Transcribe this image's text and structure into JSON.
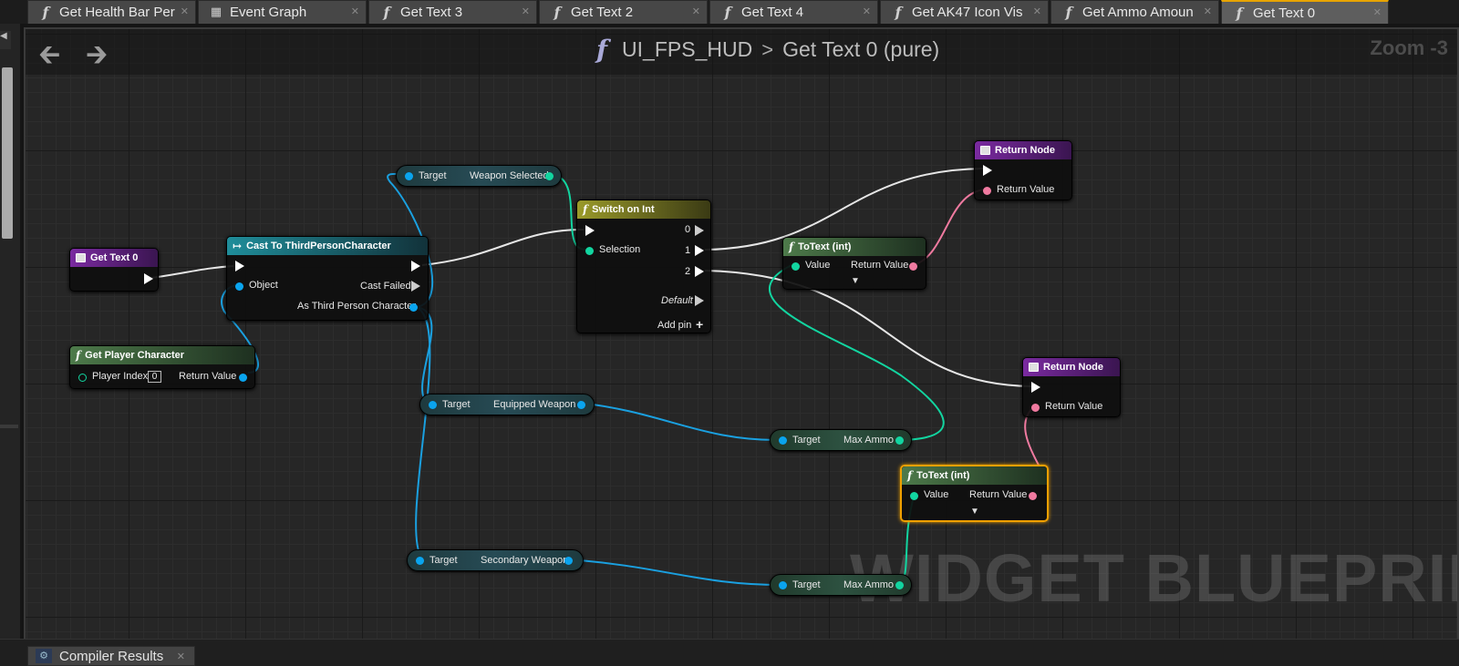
{
  "tabs": [
    {
      "label": "Get Health Bar Per",
      "icon": "function-icon",
      "active": false
    },
    {
      "label": "Event Graph",
      "icon": "event-graph-icon",
      "active": false
    },
    {
      "label": "Get Text 3",
      "icon": "function-icon",
      "active": false
    },
    {
      "label": "Get Text 2",
      "icon": "function-icon",
      "active": false
    },
    {
      "label": "Get Text 4",
      "icon": "function-icon",
      "active": false
    },
    {
      "label": "Get AK47 Icon Vis",
      "icon": "function-icon",
      "active": false
    },
    {
      "label": "Get Ammo Amoun",
      "icon": "function-icon",
      "active": false
    },
    {
      "label": "Get Text 0",
      "icon": "function-icon",
      "active": true
    }
  ],
  "graph": {
    "breadcrumb": {
      "root": "UI_FPS_HUD",
      "sep": ">",
      "current": "Get Text 0 (pure)"
    },
    "zoom": "Zoom -3",
    "watermark": "WIDGET BLUEPRINT"
  },
  "nodes": {
    "get_text_0": {
      "title": "Get Text 0"
    },
    "get_player_character": {
      "title": "Get Player Character",
      "player_index_label": "Player Index",
      "player_index_value": "0",
      "return_value": "Return Value"
    },
    "cast": {
      "title": "Cast To ThirdPersonCharacter",
      "object": "Object",
      "cast_failed": "Cast Failed",
      "as_tpc": "As Third Person Character"
    },
    "weapon_selected": {
      "target": "Target",
      "output": "Weapon Selected"
    },
    "switch": {
      "title": "Switch on Int",
      "selection": "Selection",
      "out0": "0",
      "out1": "1",
      "out2": "2",
      "default": "Default",
      "add_pin": "Add pin"
    },
    "return_node_1": {
      "title": "Return Node",
      "return_value": "Return Value"
    },
    "return_node_2": {
      "title": "Return Node",
      "return_value": "Return Value"
    },
    "totext_1": {
      "title": "ToText (int)",
      "value": "Value",
      "return_value": "Return Value"
    },
    "totext_2": {
      "title": "ToText (int)",
      "value": "Value",
      "return_value": "Return Value"
    },
    "equipped_weapon": {
      "target": "Target",
      "output": "Equipped Weapon"
    },
    "max_ammo_1": {
      "target": "Target",
      "output": "Max Ammo"
    },
    "secondary_weapon": {
      "target": "Target",
      "output": "Secondary Weapon"
    },
    "max_ammo_2": {
      "target": "Target",
      "output": "Max Ammo"
    }
  },
  "bottom": {
    "compiler_tab": "Compiler Results"
  }
}
